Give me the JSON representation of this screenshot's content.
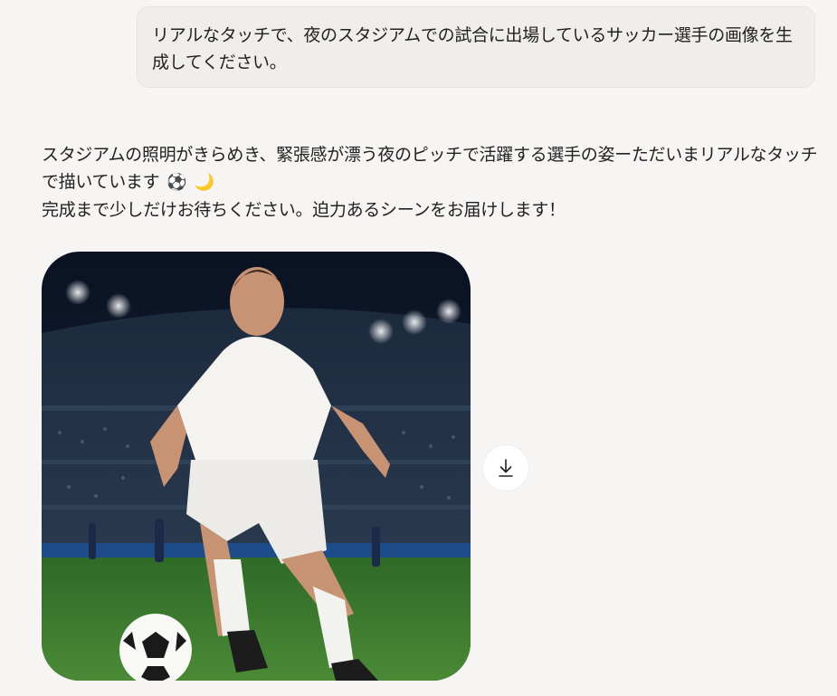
{
  "user_message": {
    "text": "リアルなタッチで、夜のスタジアムでの試合に出場しているサッカー選手の画像を生成してください。"
  },
  "assistant_message": {
    "line1": "スタジアムの照明がきらめき、緊張感が漂う夜のピッチで活躍する選手の姿ーただいまリアルなタッチで描いています",
    "emoji1": "⚽",
    "emoji2": "🌙",
    "line2": "完成まで少しだけお待ちください。迫力あるシーンをお届けします！"
  },
  "generated_image": {
    "alt": "Soccer player in white kit dribbling a ball in a night stadium"
  },
  "download_button": {
    "icon": "download-arrow-icon"
  },
  "colors": {
    "background": "#f7f5f3",
    "bubble": "#f0eeeb",
    "pitch": "#3d7a2e",
    "sky": "#0c1628"
  }
}
